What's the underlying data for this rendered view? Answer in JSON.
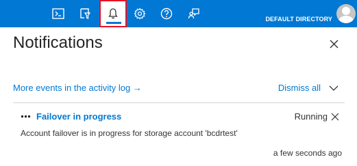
{
  "topbar": {
    "buttons": [
      {
        "name": "cloud-shell-icon",
        "label": "Cloud Shell"
      },
      {
        "name": "directory-filter-icon",
        "label": "Directory + subscription filter"
      },
      {
        "name": "notifications-bell-icon",
        "label": "Notifications",
        "active": true
      },
      {
        "name": "settings-gear-icon",
        "label": "Settings"
      },
      {
        "name": "help-icon",
        "label": "Help"
      },
      {
        "name": "feedback-icon",
        "label": "Feedback"
      }
    ],
    "directory_label": "DEFAULT DIRECTORY",
    "colors": {
      "bar": "#0078d4",
      "highlight_border": "#e81123"
    }
  },
  "panel": {
    "title": "Notifications",
    "activity_link": "More events in the activity log →",
    "dismiss_all": "Dismiss all"
  },
  "notifications": [
    {
      "title": "Failover in progress",
      "status": "Running",
      "description": "Account failover is in progress for storage account 'bcdrtest'",
      "time": "a few seconds ago"
    }
  ]
}
